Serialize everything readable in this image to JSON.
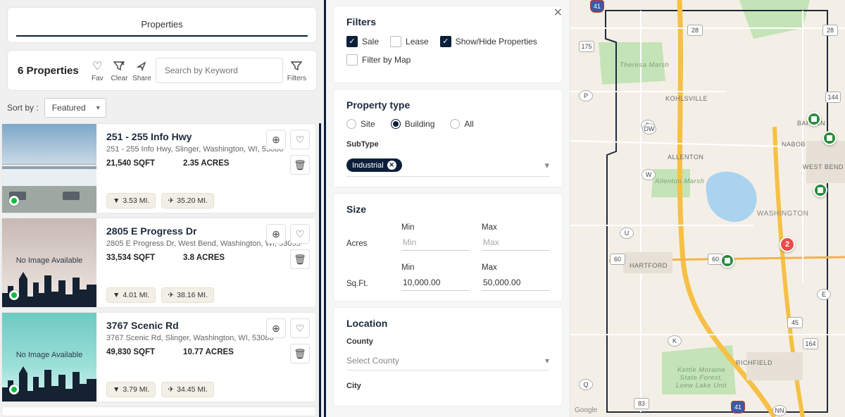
{
  "tabs": {
    "properties": "Properties"
  },
  "toolbar": {
    "count_label": "6 Properties",
    "fav_label": "Fav",
    "clear_label": "Clear",
    "share_label": "Share",
    "filters_label": "Filters",
    "search_placeholder": "Search by Keyword"
  },
  "sort": {
    "label": "Sort by :",
    "selected": "Featured"
  },
  "properties": [
    {
      "title": "251 - 255 Info Hwy",
      "address": "251 - 255 Info Hwy, Slinger, Washington, WI, 53086",
      "sqft": "21,540 SQFT",
      "acres": "2.35 ACRES",
      "dist1": "3.53 MI.",
      "dist2": "35.20 MI.",
      "image_kind": "photo"
    },
    {
      "title": "2805 E Progress Dr",
      "address": "2805 E Progress Dr, West Bend, Washington, WI, 53095",
      "sqft": "33,534 SQFT",
      "acres": "3.8 ACRES",
      "dist1": "4.01 MI.",
      "dist2": "38.16 MI.",
      "image_kind": "placeholder"
    },
    {
      "title": "3767 Scenic Rd",
      "address": "3767 Scenic Rd, Slinger, Washington, WI, 53086",
      "sqft": "49,830 SQFT",
      "acres": "10.77 ACRES",
      "dist1": "3.79 MI.",
      "dist2": "34.45 MI.",
      "image_kind": "green"
    }
  ],
  "noimage_text": "No Image Available",
  "filters": {
    "heading": "Filters",
    "sale": "Sale",
    "lease": "Lease",
    "showhide": "Show/Hide Properties",
    "filter_by_map": "Filter by Map",
    "property_type_heading": "Property type",
    "radio_site": "Site",
    "radio_building": "Building",
    "radio_all": "All",
    "subtype_label": "SubType",
    "subtype_chip": "Industrial",
    "size_heading": "Size",
    "acres_label": "Acres",
    "sqft_label": "Sq.Ft.",
    "min_label": "Min",
    "max_label": "Max",
    "min_placeholder": "Min",
    "max_placeholder": "Max",
    "sqft_min_value": "10,000.00",
    "sqft_max_value": "50,000.00",
    "location_heading": "Location",
    "county_label": "County",
    "county_placeholder": "Select County",
    "city_label": "City"
  },
  "map": {
    "labels": {
      "kohlsville": "KOHLSVILLE",
      "barton": "BARTON",
      "nabob": "NABOB",
      "allenton": "ALLENTON",
      "westbend": "WEST BEND",
      "washington": "Washington",
      "hartford": "HARTFORD",
      "richfield": "RICHFIELD",
      "theresa_marsh": "Theresa Marsh",
      "allenton_marsh": "Allenton Marsh",
      "kettle": "Kettle Moraine State Forest, Loew Lake Unit"
    },
    "routes": {
      "r28a": "28",
      "r28b": "28",
      "r175": "175",
      "r144": "144",
      "rP": "P",
      "rD": "D",
      "rDW": "DW",
      "rW": "W",
      "rU": "U",
      "r60a": "60",
      "r60b": "60",
      "rK": "K",
      "r164": "164",
      "rQ": "Q",
      "r41t": "41",
      "r41b": "41",
      "r83": "83",
      "r45": "45",
      "rNN": "NN",
      "rE": "E"
    },
    "cluster_value": "2",
    "credit": "Google"
  }
}
